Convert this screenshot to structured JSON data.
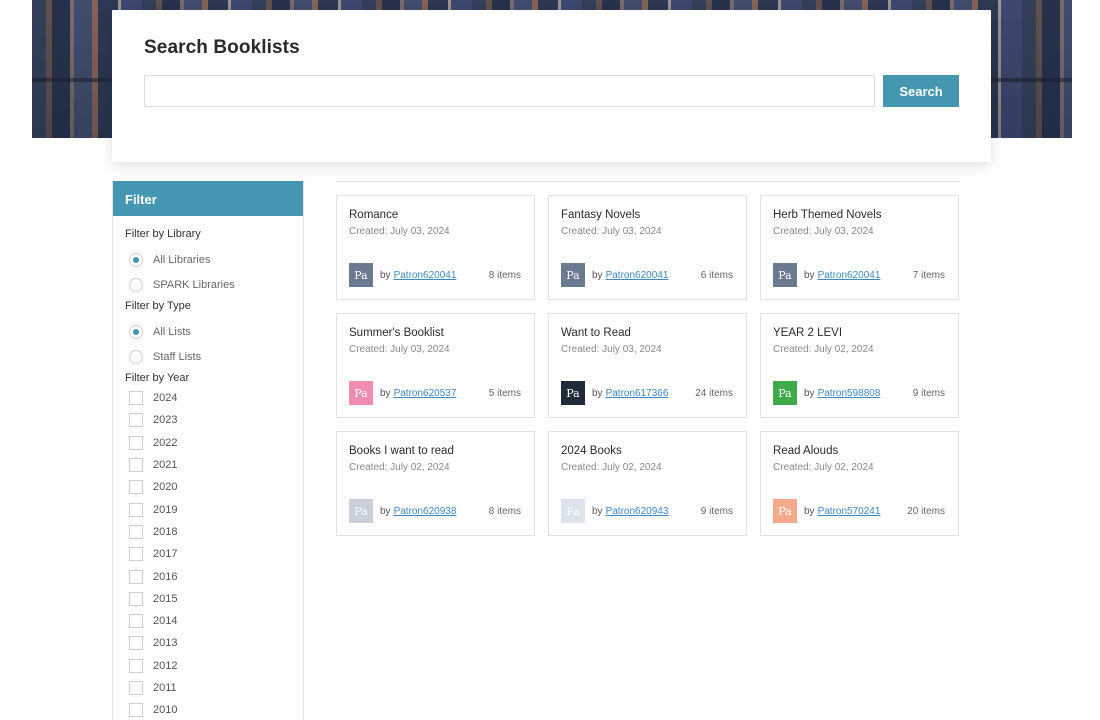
{
  "search": {
    "title": "Search Booklists",
    "input_value": "",
    "placeholder": "",
    "button_label": "Search"
  },
  "filter": {
    "header": "Filter",
    "library": {
      "title": "Filter by Library",
      "options": [
        {
          "label": "All Libraries",
          "checked": true
        },
        {
          "label": "SPARK Libraries",
          "checked": false
        }
      ]
    },
    "type": {
      "title": "Filter by Type",
      "options": [
        {
          "label": "All Lists",
          "checked": true
        },
        {
          "label": "Staff Lists",
          "checked": false
        }
      ]
    },
    "year": {
      "title": "Filter by Year",
      "options": [
        "2024",
        "2023",
        "2022",
        "2021",
        "2020",
        "2019",
        "2018",
        "2017",
        "2016",
        "2015",
        "2014",
        "2013",
        "2012",
        "2011",
        "2010"
      ]
    }
  },
  "colors": {
    "accent": "#4596b0",
    "link": "#3d87c4"
  },
  "booklists": [
    {
      "title": "Romance",
      "created": "Created: July 03, 2024",
      "avatar": "Pa",
      "avatar_bg": "#6b7a90",
      "avatar_fg": "#ffffff",
      "by": "by",
      "owner": "Patron620041",
      "count": "8 items"
    },
    {
      "title": "Fantasy Novels",
      "created": "Created: July 03, 2024",
      "avatar": "Pa",
      "avatar_bg": "#6b7a90",
      "avatar_fg": "#ffffff",
      "by": "by",
      "owner": "Patron620041",
      "count": "6 items"
    },
    {
      "title": "Herb Themed Novels",
      "created": "Created: July 03, 2024",
      "avatar": "Pa",
      "avatar_bg": "#6b7a90",
      "avatar_fg": "#ffffff",
      "by": "by",
      "owner": "Patron620041",
      "count": "7 items"
    },
    {
      "title": "Summer's Booklist",
      "created": "Created: July 03, 2024",
      "avatar": "Pa",
      "avatar_bg": "#f08cb0",
      "avatar_fg": "#ffffff",
      "by": "by",
      "owner": "Patron620537",
      "count": "5 items"
    },
    {
      "title": "Want to Read",
      "created": "Created: July 03, 2024",
      "avatar": "Pa",
      "avatar_bg": "#1f2a3a",
      "avatar_fg": "#ffffff",
      "by": "by",
      "owner": "Patron617366",
      "count": "24 items"
    },
    {
      "title": "YEAR 2 LEVI",
      "created": "Created: July 02, 2024",
      "avatar": "Pa",
      "avatar_bg": "#3fa84a",
      "avatar_fg": "#ffffff",
      "by": "by",
      "owner": "Patron598808",
      "count": "9 items"
    },
    {
      "title": "Books I want to read",
      "created": "Created: July 02, 2024",
      "avatar": "Pa",
      "avatar_bg": "#c9d0dc",
      "avatar_fg": "#ffffff",
      "by": "by",
      "owner": "Patron620938",
      "count": "8 items"
    },
    {
      "title": "2024 Books",
      "created": "Created: July 02, 2024",
      "avatar": "Pa",
      "avatar_bg": "#dde3ec",
      "avatar_fg": "#ffffff",
      "by": "by",
      "owner": "Patron620943",
      "count": "9 items"
    },
    {
      "title": "Read Alouds",
      "created": "Created: July 02, 2024",
      "avatar": "Pa",
      "avatar_bg": "#f4ab8c",
      "avatar_fg": "#ffffff",
      "by": "by",
      "owner": "Patron570241",
      "count": "20 items"
    }
  ]
}
